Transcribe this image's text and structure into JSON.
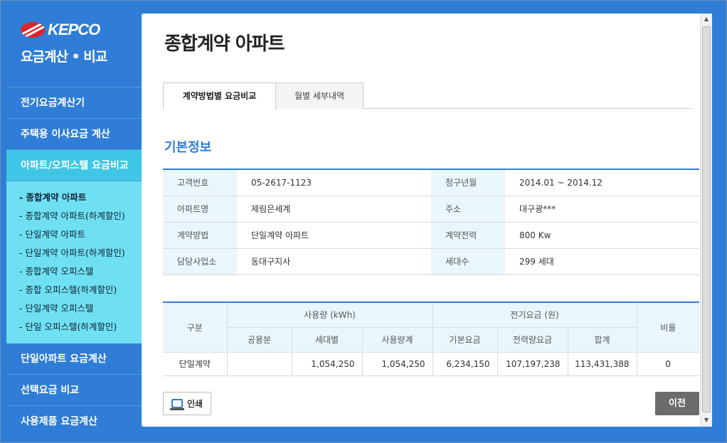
{
  "brand": {
    "logo_text": "KEPCO",
    "subtitle": "요금계산 • 비교"
  },
  "sidebar": {
    "items_top": [
      {
        "label": "전기요금계산기"
      },
      {
        "label": "주택용 이사요금 계산"
      },
      {
        "label": "아파트/오피스텔 요금비교"
      }
    ],
    "subitems": [
      {
        "label": "- 종합계약 아파트"
      },
      {
        "label": "- 종합계약 아파트(하계할인)"
      },
      {
        "label": "- 단일계약 아파트"
      },
      {
        "label": "- 단일계약 아파트(하계할인)"
      },
      {
        "label": "- 종합계약 오피스텔"
      },
      {
        "label": "- 종합 오피스텔(하계할인)"
      },
      {
        "label": "- 단일계약 오피스텔"
      },
      {
        "label": "- 단일 오피스텔(하계할인)"
      }
    ],
    "items_bottom": [
      {
        "label": "단일아파트 요금계산"
      },
      {
        "label": "선택요금 비교"
      },
      {
        "label": "사용제품 요금계산"
      }
    ]
  },
  "page": {
    "title": "종합계약 아파트"
  },
  "tabs": [
    {
      "label": "계약방법별 요금비교"
    },
    {
      "label": "월별 세부내역"
    }
  ],
  "section": {
    "title": "기본정보"
  },
  "info": {
    "rows": [
      {
        "l1": "고객번호",
        "v1": "05-2617-1123",
        "l2": "청구년월",
        "v2": "2014.01 ~ 2014.12"
      },
      {
        "l1": "아파트명",
        "v1": "제림은세계",
        "l2": "주소",
        "v2": "대구광***"
      },
      {
        "l1": "계약방법",
        "v1": "단일계약 아파트",
        "l2": "계약전력",
        "v2": "800 Kw"
      },
      {
        "l1": "담당사업소",
        "v1": "동대구지사",
        "l2": "세대수",
        "v2": "299 세대"
      }
    ]
  },
  "usage": {
    "headers": {
      "category": "구분",
      "usage_group": "사용량 (kWh)",
      "fee_group": "전기요금 (원)",
      "ratio": "비율",
      "common": "공용분",
      "household": "세대별",
      "usage_total": "사용량계",
      "base_fee": "기본요금",
      "energy_fee": "전력량요금",
      "total": "합계"
    },
    "row": {
      "category": "단일계약",
      "common": "",
      "household": "1,054,250",
      "usage_total": "1,054,250",
      "base_fee": "6,234,150",
      "energy_fee": "107,197,238",
      "total": "113,431,388",
      "ratio": "0"
    }
  },
  "buttons": {
    "print": "인쇄",
    "prev": "이전"
  },
  "colors": {
    "brand_blue": "#2f7dd6",
    "active_cyan": "#3fc6e6",
    "subnav_bg": "#6ee0f2",
    "header_bg": "#e9f6fb"
  }
}
